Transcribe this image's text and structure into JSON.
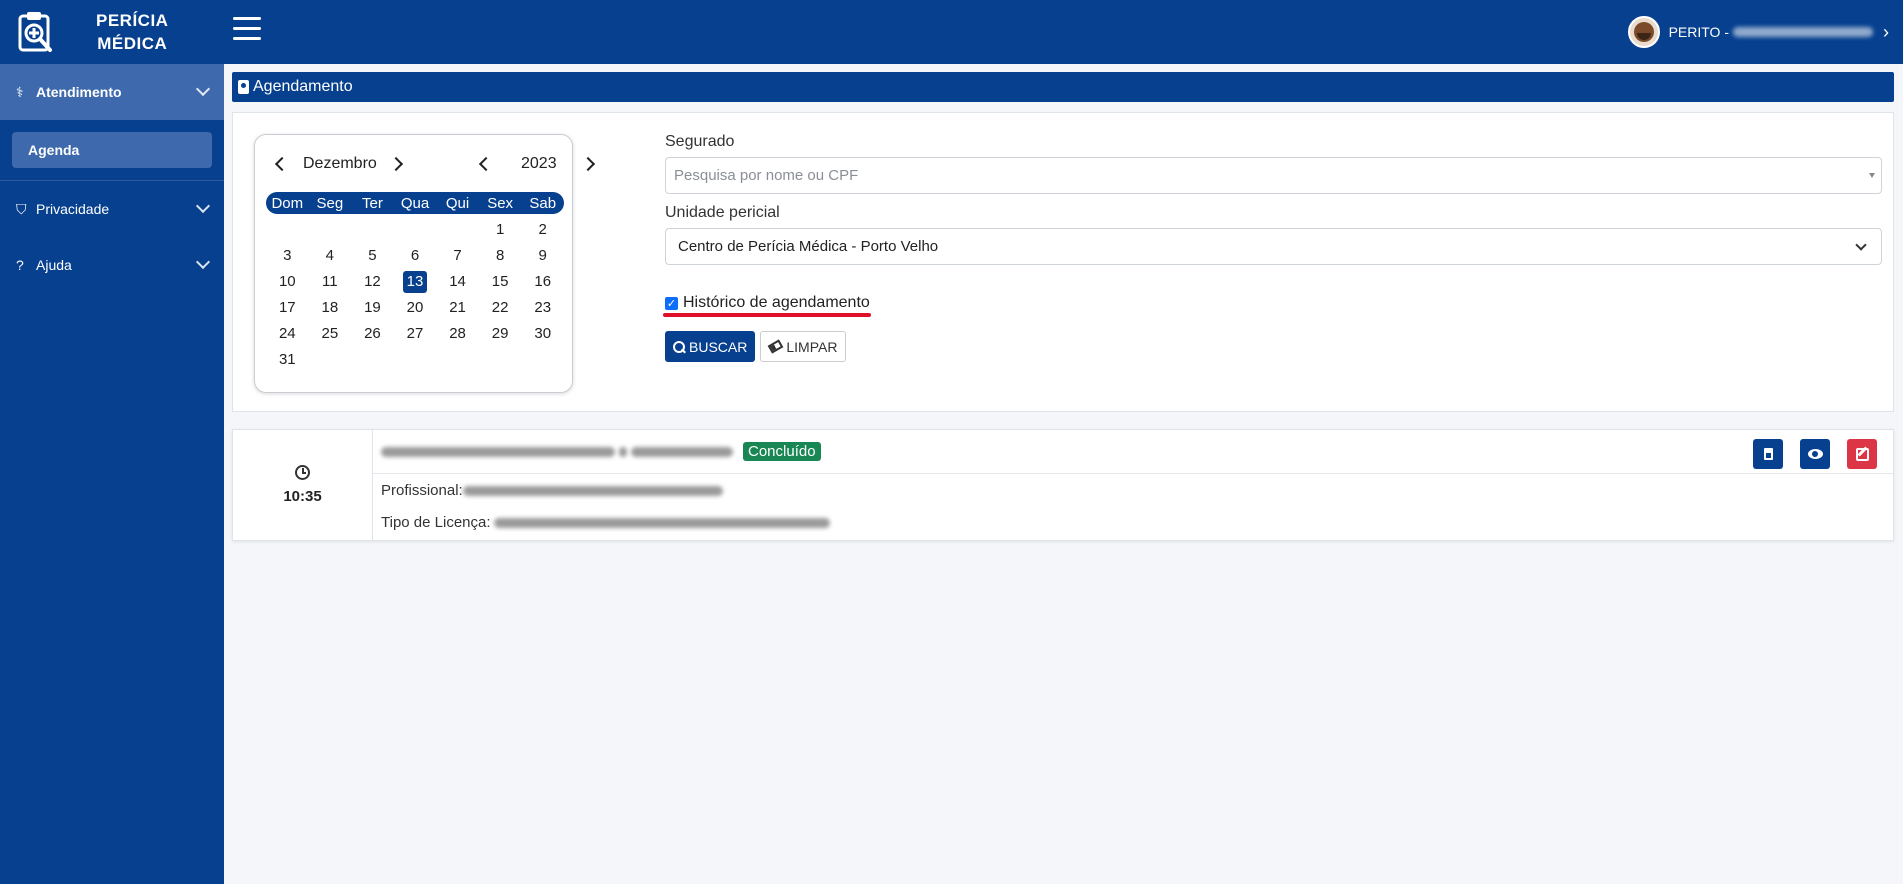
{
  "app": {
    "logo_line1": "PERÍCIA",
    "logo_line2": "MÉDICA"
  },
  "header": {
    "user_prefix": "PERITO -"
  },
  "sidebar": {
    "items": [
      {
        "label": "Atendimento",
        "icon": "stethoscope-icon",
        "expanded": true
      },
      {
        "label": "Privacidade",
        "icon": "shield-icon",
        "expanded": false
      },
      {
        "label": "Ajuda",
        "icon": "question-icon",
        "expanded": false
      }
    ],
    "subitems": [
      {
        "label": "Agenda",
        "active": true
      }
    ]
  },
  "page": {
    "title": "Agendamento"
  },
  "calendar": {
    "month": "Dezembro",
    "year": "2023",
    "weekdays": [
      "Dom",
      "Seg",
      "Ter",
      "Qua",
      "Qui",
      "Sex",
      "Sab"
    ],
    "leading_blanks": 5,
    "days_in_month": 31,
    "selected_day": 13
  },
  "form": {
    "segurado_label": "Segurado",
    "segurado_placeholder": "Pesquisa por nome ou CPF",
    "unidade_label": "Unidade pericial",
    "unidade_value": "Centro de Perícia Médica - Porto Velho",
    "historico_label": "Histórico de agendamento",
    "historico_checked": true,
    "buscar_label": "BUSCAR",
    "limpar_label": "LIMPAR"
  },
  "appointment": {
    "time": "10:35",
    "status": "Concluído",
    "profissional_label": "Profissional:",
    "licenca_label": "Tipo de Licença:"
  },
  "colors": {
    "primary": "#07408f",
    "sidebar_active": "#3e69ac",
    "success": "#198754",
    "danger": "#dc3545",
    "highlight_underline": "#e0102a"
  }
}
